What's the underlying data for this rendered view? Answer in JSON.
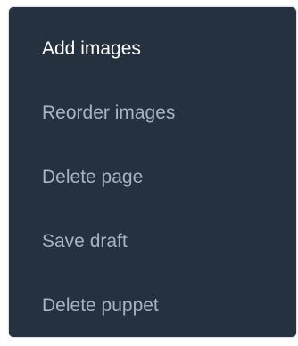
{
  "context_menu": {
    "items": [
      {
        "label": "Add images"
      },
      {
        "label": "Reorder images"
      },
      {
        "label": "Delete page"
      },
      {
        "label": "Save draft"
      },
      {
        "label": "Delete puppet"
      }
    ]
  },
  "colors": {
    "menu_background": "#25313f",
    "first_item_text": "#ffffff",
    "item_text": "#a9b3c0"
  }
}
